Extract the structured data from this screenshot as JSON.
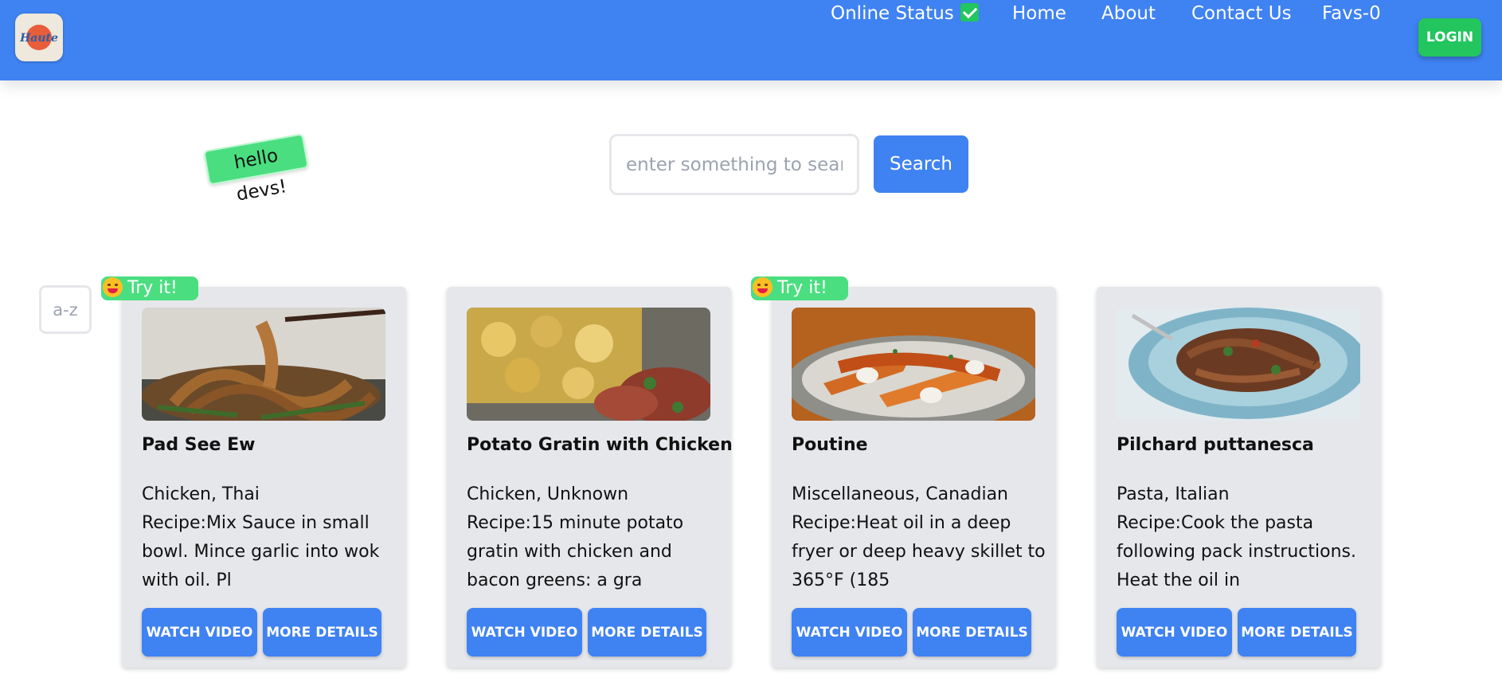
{
  "header": {
    "logo_text": "Haute",
    "nav": {
      "online_status": "Online Status",
      "home": "Home",
      "about": "About",
      "contact": "Contact Us",
      "favs": "Favs-0"
    },
    "login": "LOGIN"
  },
  "sticker": "hello devs!",
  "search": {
    "placeholder": "enter something to search",
    "button": "Search"
  },
  "sort_label": "a-z",
  "badge_label": "Try it!",
  "cards": [
    {
      "title": "Pad See Ew",
      "category": "Chicken, Thai",
      "recipe_lines": [
        "Recipe:Mix Sauce in small",
        "bowl. Mince garlic into wok",
        "with oil. Pl"
      ],
      "watch": "WATCH VIDEO",
      "more": "MORE DETAILS",
      "has_badge": true
    },
    {
      "title": "Potato Gratin with Chicken",
      "category": "Chicken, Unknown",
      "recipe_lines": [
        "Recipe:15 minute potato",
        "gratin with chicken and",
        "bacon greens: a gra"
      ],
      "watch": "WATCH VIDEO",
      "more": "MORE DETAILS",
      "has_badge": false
    },
    {
      "title": "Poutine",
      "category": "Miscellaneous, Canadian",
      "recipe_lines": [
        "Recipe:Heat oil in a deep",
        "fryer or deep heavy skillet to",
        "365°F (185"
      ],
      "watch": "WATCH VIDEO",
      "more": "MORE DETAILS",
      "has_badge": true
    },
    {
      "title": "Pilchard puttanesca",
      "category": "Pasta, Italian",
      "recipe_lines": [
        "Recipe:Cook the pasta",
        "following pack instructions.",
        "Heat the oil in"
      ],
      "watch": "WATCH VIDEO",
      "more": "MORE DETAILS",
      "has_badge": false
    }
  ],
  "colors": {
    "primary": "#3f82f2",
    "success": "#22c55e",
    "badge": "#4ade80",
    "card_bg": "#e5e7eb"
  }
}
